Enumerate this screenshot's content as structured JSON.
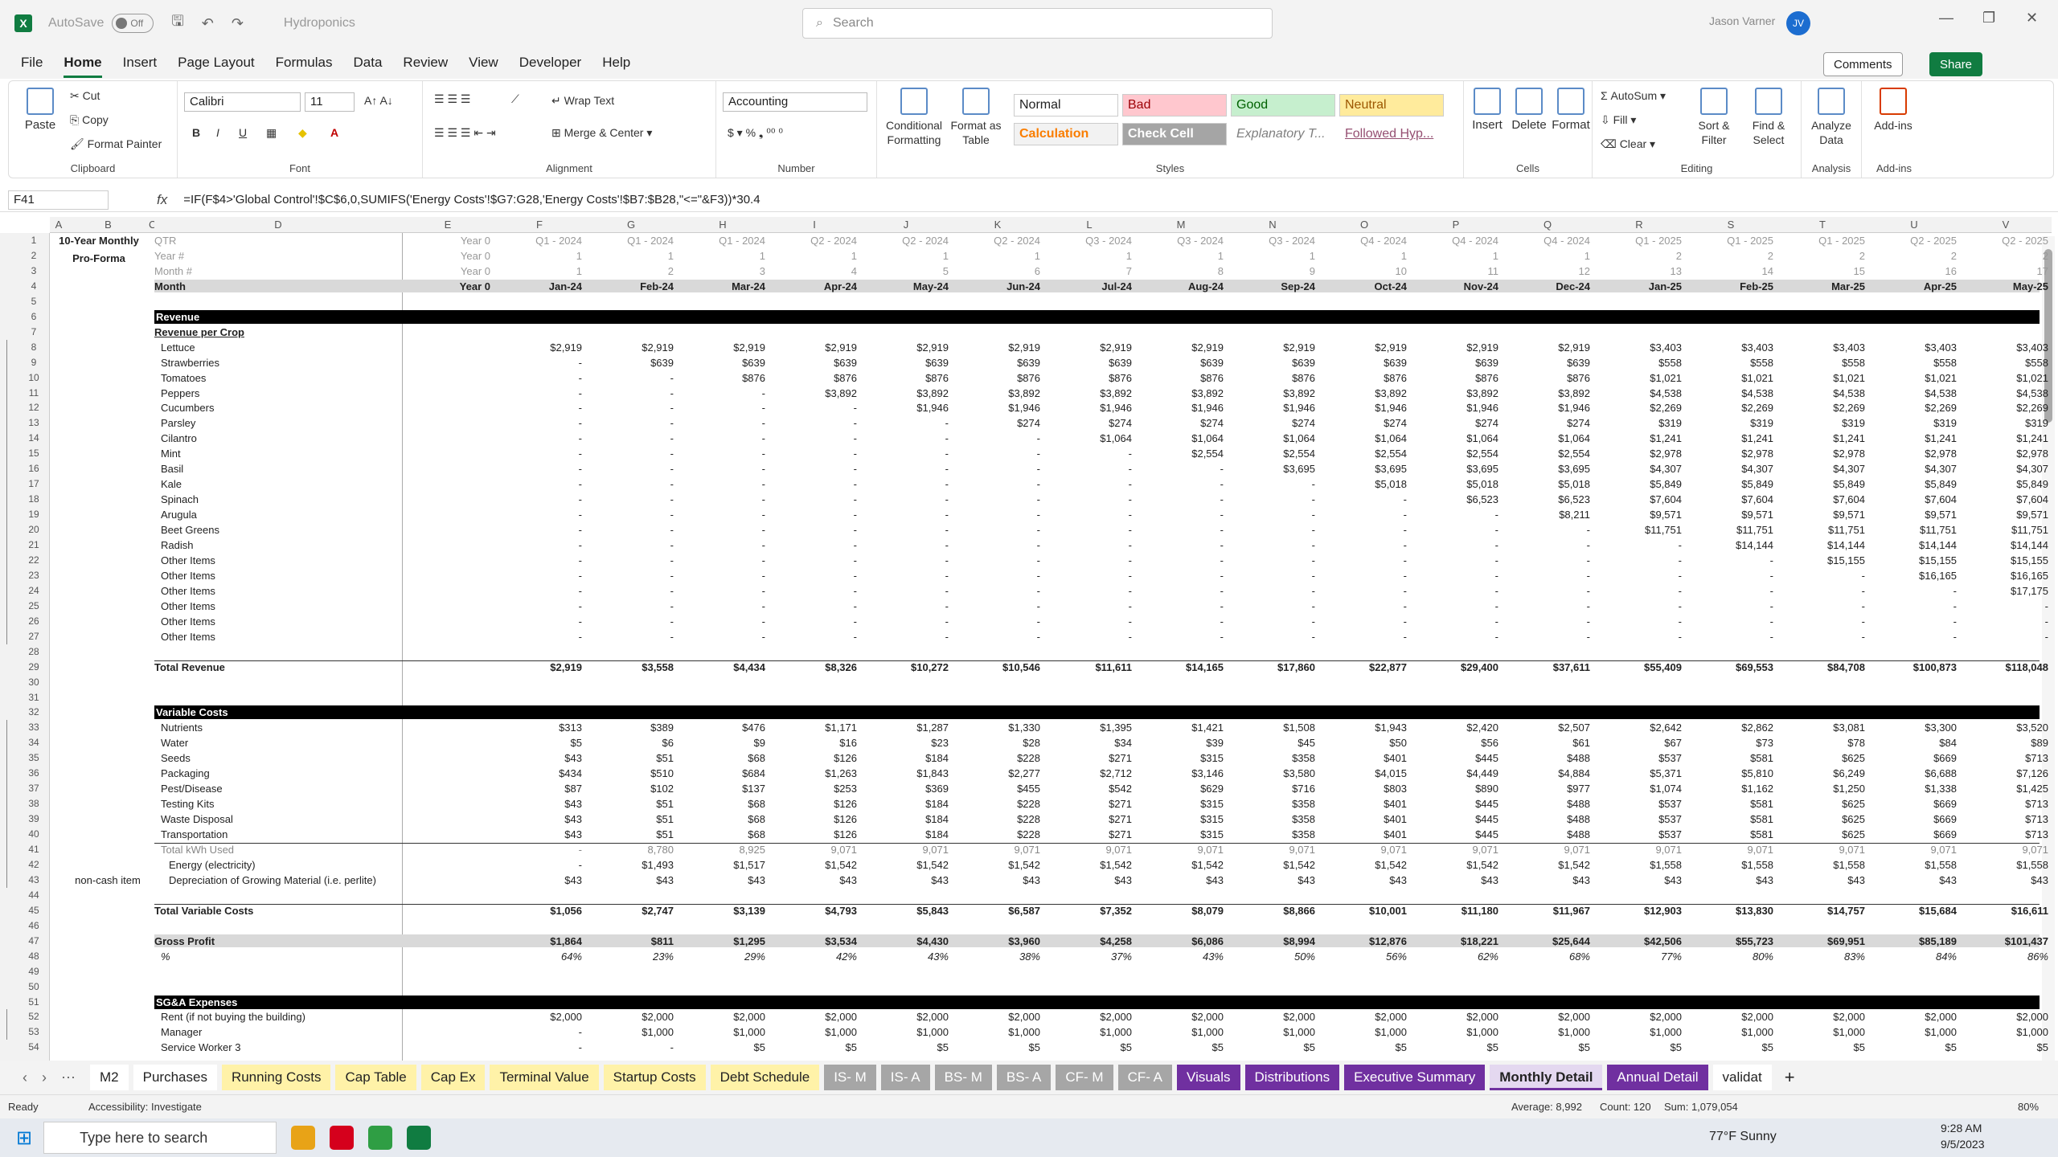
{
  "titlebar": {
    "autosave": "AutoSave",
    "autosave_state": "Off",
    "filename": "Hydroponics",
    "search_placeholder": "Search",
    "user": "Jason Varner",
    "initials": "JV"
  },
  "menu": [
    "File",
    "Home",
    "Insert",
    "Page Layout",
    "Formulas",
    "Data",
    "Review",
    "View",
    "Developer",
    "Help"
  ],
  "menu_buttons": {
    "comments": "Comments",
    "share": "Share"
  },
  "ribbon": {
    "clipboard": {
      "label": "Clipboard",
      "paste": "Paste",
      "cut": "Cut",
      "copy": "Copy",
      "format_painter": "Format Painter"
    },
    "font": {
      "label": "Font",
      "name": "Calibri",
      "size": "11"
    },
    "alignment": {
      "label": "Alignment",
      "wrap": "Wrap Text",
      "merge": "Merge & Center"
    },
    "number": {
      "label": "Number",
      "format": "Accounting"
    },
    "styles": {
      "label": "Styles",
      "cond": "Conditional Formatting",
      "fmt_table": "Format as Table",
      "normal": "Normal",
      "bad": "Bad",
      "good": "Good",
      "neutral": "Neutral",
      "calculation": "Calculation",
      "check": "Check Cell",
      "explanatory": "Explanatory T...",
      "followed": "Followed Hyp..."
    },
    "cells": {
      "label": "Cells",
      "insert": "Insert",
      "delete": "Delete",
      "format": "Format"
    },
    "editing": {
      "label": "Editing",
      "autosum": "AutoSum",
      "fill": "Fill",
      "clear": "Clear",
      "sort": "Sort & Filter",
      "find": "Find & Select"
    },
    "analysis": {
      "label": "Analysis",
      "analyze": "Analyze Data"
    },
    "addins": {
      "label": "Add-ins",
      "addins": "Add-ins"
    }
  },
  "formula_bar": {
    "cell": "F41",
    "fx": "fx",
    "formula": "=IF(F$4>'Global Control'!$C$6,0,SUMIFS('Energy Costs'!$G7:G28,'Energy Costs'!$B7:$B28,\"<=\"&F3))*30.4"
  },
  "columns": [
    "A",
    "B",
    "C",
    "D",
    "E",
    "F",
    "G",
    "H",
    "I",
    "J",
    "K",
    "L",
    "M",
    "N",
    "O",
    "P",
    "Q",
    "R",
    "S",
    "T",
    "U",
    "V"
  ],
  "sheet": {
    "title1": "10-Year Monthly",
    "title2": "Pro-Forma",
    "hdr_labels": [
      "QTR",
      "Year #",
      "Month #",
      "Month"
    ],
    "qtr": [
      "Year 0",
      "Q1 - 2024",
      "Q1 - 2024",
      "Q1 - 2024",
      "Q2 - 2024",
      "Q2 - 2024",
      "Q2 - 2024",
      "Q3 - 2024",
      "Q3 - 2024",
      "Q3 - 2024",
      "Q4 - 2024",
      "Q4 - 2024",
      "Q4 - 2024",
      "Q1 - 2025",
      "Q1 - 2025",
      "Q1 - 2025",
      "Q2 - 2025",
      "Q2 - 2025"
    ],
    "year": [
      "Year 0",
      "1",
      "1",
      "1",
      "1",
      "1",
      "1",
      "1",
      "1",
      "1",
      "1",
      "1",
      "1",
      "2",
      "2",
      "2",
      "2",
      "2"
    ],
    "monthnum": [
      "Year 0",
      "1",
      "2",
      "3",
      "4",
      "5",
      "6",
      "7",
      "8",
      "9",
      "10",
      "11",
      "12",
      "13",
      "14",
      "15",
      "16",
      "17"
    ],
    "month": [
      "Year 0",
      "Jan-24",
      "Feb-24",
      "Mar-24",
      "Apr-24",
      "May-24",
      "Jun-24",
      "Jul-24",
      "Aug-24",
      "Sep-24",
      "Oct-24",
      "Nov-24",
      "Dec-24",
      "Jan-25",
      "Feb-25",
      "Mar-25",
      "Apr-25",
      "May-25"
    ],
    "revenue_header": "Revenue",
    "rev_per_crop": "Revenue per Crop",
    "crops": [
      {
        "name": "Lettuce",
        "v": [
          "",
          "$2,919",
          "$2,919",
          "$2,919",
          "$2,919",
          "$2,919",
          "$2,919",
          "$2,919",
          "$2,919",
          "$2,919",
          "$2,919",
          "$2,919",
          "$2,919",
          "$3,403",
          "$3,403",
          "$3,403",
          "$3,403",
          "$3,403"
        ]
      },
      {
        "name": "Strawberries",
        "v": [
          "",
          "-",
          "$639",
          "$639",
          "$639",
          "$639",
          "$639",
          "$639",
          "$639",
          "$639",
          "$639",
          "$639",
          "$639",
          "$558",
          "$558",
          "$558",
          "$558",
          "$558"
        ]
      },
      {
        "name": "Tomatoes",
        "v": [
          "",
          "-",
          "-",
          "$876",
          "$876",
          "$876",
          "$876",
          "$876",
          "$876",
          "$876",
          "$876",
          "$876",
          "$876",
          "$1,021",
          "$1,021",
          "$1,021",
          "$1,021",
          "$1,021"
        ]
      },
      {
        "name": "Peppers",
        "v": [
          "",
          "-",
          "-",
          "-",
          "$3,892",
          "$3,892",
          "$3,892",
          "$3,892",
          "$3,892",
          "$3,892",
          "$3,892",
          "$3,892",
          "$3,892",
          "$4,538",
          "$4,538",
          "$4,538",
          "$4,538",
          "$4,538"
        ]
      },
      {
        "name": "Cucumbers",
        "v": [
          "",
          "-",
          "-",
          "-",
          "-",
          "$1,946",
          "$1,946",
          "$1,946",
          "$1,946",
          "$1,946",
          "$1,946",
          "$1,946",
          "$1,946",
          "$2,269",
          "$2,269",
          "$2,269",
          "$2,269",
          "$2,269"
        ]
      },
      {
        "name": "Parsley",
        "v": [
          "",
          "-",
          "-",
          "-",
          "-",
          "-",
          "$274",
          "$274",
          "$274",
          "$274",
          "$274",
          "$274",
          "$274",
          "$319",
          "$319",
          "$319",
          "$319",
          "$319"
        ]
      },
      {
        "name": "Cilantro",
        "v": [
          "",
          "-",
          "-",
          "-",
          "-",
          "-",
          "-",
          "$1,064",
          "$1,064",
          "$1,064",
          "$1,064",
          "$1,064",
          "$1,064",
          "$1,241",
          "$1,241",
          "$1,241",
          "$1,241",
          "$1,241"
        ]
      },
      {
        "name": "Mint",
        "v": [
          "",
          "-",
          "-",
          "-",
          "-",
          "-",
          "-",
          "-",
          "$2,554",
          "$2,554",
          "$2,554",
          "$2,554",
          "$2,554",
          "$2,978",
          "$2,978",
          "$2,978",
          "$2,978",
          "$2,978"
        ]
      },
      {
        "name": "Basil",
        "v": [
          "",
          "-",
          "-",
          "-",
          "-",
          "-",
          "-",
          "-",
          "-",
          "$3,695",
          "$3,695",
          "$3,695",
          "$3,695",
          "$4,307",
          "$4,307",
          "$4,307",
          "$4,307",
          "$4,307"
        ]
      },
      {
        "name": "Kale",
        "v": [
          "",
          "-",
          "-",
          "-",
          "-",
          "-",
          "-",
          "-",
          "-",
          "-",
          "$5,018",
          "$5,018",
          "$5,018",
          "$5,849",
          "$5,849",
          "$5,849",
          "$5,849",
          "$5,849"
        ]
      },
      {
        "name": "Spinach",
        "v": [
          "",
          "-",
          "-",
          "-",
          "-",
          "-",
          "-",
          "-",
          "-",
          "-",
          "-",
          "$6,523",
          "$6,523",
          "$7,604",
          "$7,604",
          "$7,604",
          "$7,604",
          "$7,604"
        ]
      },
      {
        "name": "Arugula",
        "v": [
          "",
          "-",
          "-",
          "-",
          "-",
          "-",
          "-",
          "-",
          "-",
          "-",
          "-",
          "-",
          "$8,211",
          "$9,571",
          "$9,571",
          "$9,571",
          "$9,571",
          "$9,571"
        ]
      },
      {
        "name": "Beet Greens",
        "v": [
          "",
          "-",
          "-",
          "-",
          "-",
          "-",
          "-",
          "-",
          "-",
          "-",
          "-",
          "-",
          "-",
          "$11,751",
          "$11,751",
          "$11,751",
          "$11,751",
          "$11,751"
        ]
      },
      {
        "name": "Radish",
        "v": [
          "",
          "-",
          "-",
          "-",
          "-",
          "-",
          "-",
          "-",
          "-",
          "-",
          "-",
          "-",
          "-",
          "-",
          "$14,144",
          "$14,144",
          "$14,144",
          "$14,144"
        ]
      },
      {
        "name": "Other Items",
        "v": [
          "",
          "-",
          "-",
          "-",
          "-",
          "-",
          "-",
          "-",
          "-",
          "-",
          "-",
          "-",
          "-",
          "-",
          "-",
          "$15,155",
          "$15,155",
          "$15,155"
        ]
      },
      {
        "name": "Other Items",
        "v": [
          "",
          "-",
          "-",
          "-",
          "-",
          "-",
          "-",
          "-",
          "-",
          "-",
          "-",
          "-",
          "-",
          "-",
          "-",
          "-",
          "$16,165",
          "$16,165"
        ]
      },
      {
        "name": "Other Items",
        "v": [
          "",
          "-",
          "-",
          "-",
          "-",
          "-",
          "-",
          "-",
          "-",
          "-",
          "-",
          "-",
          "-",
          "-",
          "-",
          "-",
          "-",
          "$17,175"
        ]
      },
      {
        "name": "Other Items",
        "v": [
          "",
          "-",
          "-",
          "-",
          "-",
          "-",
          "-",
          "-",
          "-",
          "-",
          "-",
          "-",
          "-",
          "-",
          "-",
          "-",
          "-",
          "-"
        ]
      },
      {
        "name": "Other Items",
        "v": [
          "",
          "-",
          "-",
          "-",
          "-",
          "-",
          "-",
          "-",
          "-",
          "-",
          "-",
          "-",
          "-",
          "-",
          "-",
          "-",
          "-",
          "-"
        ]
      },
      {
        "name": "Other Items",
        "v": [
          "",
          "-",
          "-",
          "-",
          "-",
          "-",
          "-",
          "-",
          "-",
          "-",
          "-",
          "-",
          "-",
          "-",
          "-",
          "-",
          "-",
          "-"
        ]
      }
    ],
    "total_revenue": {
      "name": "Total Revenue",
      "v": [
        "",
        "$2,919",
        "$3,558",
        "$4,434",
        "$8,326",
        "$10,272",
        "$10,546",
        "$11,611",
        "$14,165",
        "$17,860",
        "$22,877",
        "$29,400",
        "$37,611",
        "$55,409",
        "$69,553",
        "$84,708",
        "$100,873",
        "$118,048"
      ]
    },
    "varcost_header": "Variable Costs",
    "varcosts": [
      {
        "name": "Nutrients",
        "v": [
          "",
          "$313",
          "$389",
          "$476",
          "$1,171",
          "$1,287",
          "$1,330",
          "$1,395",
          "$1,421",
          "$1,508",
          "$1,943",
          "$2,420",
          "$2,507",
          "$2,642",
          "$2,862",
          "$3,081",
          "$3,300",
          "$3,520"
        ]
      },
      {
        "name": "Water",
        "v": [
          "",
          "$5",
          "$6",
          "$9",
          "$16",
          "$23",
          "$28",
          "$34",
          "$39",
          "$45",
          "$50",
          "$56",
          "$61",
          "$67",
          "$73",
          "$78",
          "$84",
          "$89"
        ]
      },
      {
        "name": "Seeds",
        "v": [
          "",
          "$43",
          "$51",
          "$68",
          "$126",
          "$184",
          "$228",
          "$271",
          "$315",
          "$358",
          "$401",
          "$445",
          "$488",
          "$537",
          "$581",
          "$625",
          "$669",
          "$713"
        ]
      },
      {
        "name": "Packaging",
        "v": [
          "",
          "$434",
          "$510",
          "$684",
          "$1,263",
          "$1,843",
          "$2,277",
          "$2,712",
          "$3,146",
          "$3,580",
          "$4,015",
          "$4,449",
          "$4,884",
          "$5,371",
          "$5,810",
          "$6,249",
          "$6,688",
          "$7,126"
        ]
      },
      {
        "name": "Pest/Disease",
        "v": [
          "",
          "$87",
          "$102",
          "$137",
          "$253",
          "$369",
          "$455",
          "$542",
          "$629",
          "$716",
          "$803",
          "$890",
          "$977",
          "$1,074",
          "$1,162",
          "$1,250",
          "$1,338",
          "$1,425"
        ]
      },
      {
        "name": "Testing Kits",
        "v": [
          "",
          "$43",
          "$51",
          "$68",
          "$126",
          "$184",
          "$228",
          "$271",
          "$315",
          "$358",
          "$401",
          "$445",
          "$488",
          "$537",
          "$581",
          "$625",
          "$669",
          "$713"
        ]
      },
      {
        "name": "Waste Disposal",
        "v": [
          "",
          "$43",
          "$51",
          "$68",
          "$126",
          "$184",
          "$228",
          "$271",
          "$315",
          "$358",
          "$401",
          "$445",
          "$488",
          "$537",
          "$581",
          "$625",
          "$669",
          "$713"
        ]
      },
      {
        "name": "Transportation",
        "v": [
          "",
          "$43",
          "$51",
          "$68",
          "$126",
          "$184",
          "$228",
          "$271",
          "$315",
          "$358",
          "$401",
          "$445",
          "$488",
          "$537",
          "$581",
          "$625",
          "$669",
          "$713"
        ]
      }
    ],
    "kwh": {
      "name": "Total kWh Used",
      "v": [
        "",
        "-",
        "8,780",
        "8,925",
        "9,071",
        "9,071",
        "9,071",
        "9,071",
        "9,071",
        "9,071",
        "9,071",
        "9,071",
        "9,071",
        "9,071",
        "9,071",
        "9,071",
        "9,071",
        "9,071"
      ]
    },
    "energy": {
      "name": "Energy (electricity)",
      "v": [
        "",
        "-",
        "$1,493",
        "$1,517",
        "$1,542",
        "$1,542",
        "$1,542",
        "$1,542",
        "$1,542",
        "$1,542",
        "$1,542",
        "$1,542",
        "$1,542",
        "$1,558",
        "$1,558",
        "$1,558",
        "$1,558",
        "$1,558"
      ]
    },
    "depr": {
      "name": "Depreciation of Growing Material (i.e. perlite)",
      "note": "non-cash item",
      "v": [
        "",
        "$43",
        "$43",
        "$43",
        "$43",
        "$43",
        "$43",
        "$43",
        "$43",
        "$43",
        "$43",
        "$43",
        "$43",
        "$43",
        "$43",
        "$43",
        "$43",
        "$43"
      ]
    },
    "total_var": {
      "name": "Total Variable Costs",
      "v": [
        "",
        "$1,056",
        "$2,747",
        "$3,139",
        "$4,793",
        "$5,843",
        "$6,587",
        "$7,352",
        "$8,079",
        "$8,866",
        "$10,001",
        "$11,180",
        "$11,967",
        "$12,903",
        "$13,830",
        "$14,757",
        "$15,684",
        "$16,611"
      ]
    },
    "gross_profit": {
      "name": "Gross Profit",
      "v": [
        "",
        "$1,864",
        "$811",
        "$1,295",
        "$3,534",
        "$4,430",
        "$3,960",
        "$4,258",
        "$6,086",
        "$8,994",
        "$12,876",
        "$18,221",
        "$25,644",
        "$42,506",
        "$55,723",
        "$69,951",
        "$85,189",
        "$101,437"
      ]
    },
    "gp_pct": {
      "name": "%",
      "v": [
        "",
        "64%",
        "23%",
        "29%",
        "42%",
        "43%",
        "38%",
        "37%",
        "43%",
        "50%",
        "56%",
        "62%",
        "68%",
        "77%",
        "80%",
        "83%",
        "84%",
        "86%"
      ]
    },
    "sga_header": "SG&A Expenses",
    "sga": [
      {
        "name": "Rent (if not buying the building)",
        "v": [
          "",
          "$2,000",
          "$2,000",
          "$2,000",
          "$2,000",
          "$2,000",
          "$2,000",
          "$2,000",
          "$2,000",
          "$2,000",
          "$2,000",
          "$2,000",
          "$2,000",
          "$2,000",
          "$2,000",
          "$2,000",
          "$2,000",
          "$2,000"
        ]
      },
      {
        "name": "Manager",
        "v": [
          "",
          "-",
          "$1,000",
          "$1,000",
          "$1,000",
          "$1,000",
          "$1,000",
          "$1,000",
          "$1,000",
          "$1,000",
          "$1,000",
          "$1,000",
          "$1,000",
          "$1,000",
          "$1,000",
          "$1,000",
          "$1,000",
          "$1,000"
        ]
      },
      {
        "name": "Service Worker 3",
        "v": [
          "",
          "-",
          "-",
          "$5",
          "$5",
          "$5",
          "$5",
          "$5",
          "$5",
          "$5",
          "$5",
          "$5",
          "$5",
          "$5",
          "$5",
          "$5",
          "$5",
          "$5"
        ]
      }
    ]
  },
  "tabs": [
    {
      "label": "M2",
      "bg": "#ffffff"
    },
    {
      "label": "Purchases",
      "bg": "#ffffff"
    },
    {
      "label": "Running Costs",
      "bg": "#fff2a8"
    },
    {
      "label": "Cap Table",
      "bg": "#fff2a8"
    },
    {
      "label": "Cap Ex",
      "bg": "#fff2a8"
    },
    {
      "label": "Terminal Value",
      "bg": "#fff2a8"
    },
    {
      "label": "Startup Costs",
      "bg": "#fff2a8"
    },
    {
      "label": "Debt Schedule",
      "bg": "#fff2a8"
    },
    {
      "label": "IS- M",
      "bg": "#a6a6a6"
    },
    {
      "label": "IS- A",
      "bg": "#a6a6a6"
    },
    {
      "label": "BS- M",
      "bg": "#a6a6a6"
    },
    {
      "label": "BS- A",
      "bg": "#a6a6a6"
    },
    {
      "label": "CF- M",
      "bg": "#a6a6a6"
    },
    {
      "label": "CF- A",
      "bg": "#a6a6a6"
    },
    {
      "label": "Visuals",
      "bg": "#7030a0"
    },
    {
      "label": "Distributions",
      "bg": "#7030a0"
    },
    {
      "label": "Executive Summary",
      "bg": "#7030a0"
    },
    {
      "label": "Monthly Detail",
      "bg": "#e4d8f0"
    },
    {
      "label": "Annual Detail",
      "bg": "#7030a0"
    },
    {
      "label": "validat",
      "bg": "#ffffff"
    }
  ],
  "status": {
    "ready": "Ready",
    "accessibility": "Accessibility: Investigate",
    "average": "Average: 8,992",
    "count": "Count: 120",
    "sum": "Sum: 1,079,054",
    "zoom": "80%"
  },
  "taskbar": {
    "search": "Type here to search",
    "weather": "77°F  Sunny",
    "time": "9:28 AM",
    "date": "9/5/2023"
  }
}
